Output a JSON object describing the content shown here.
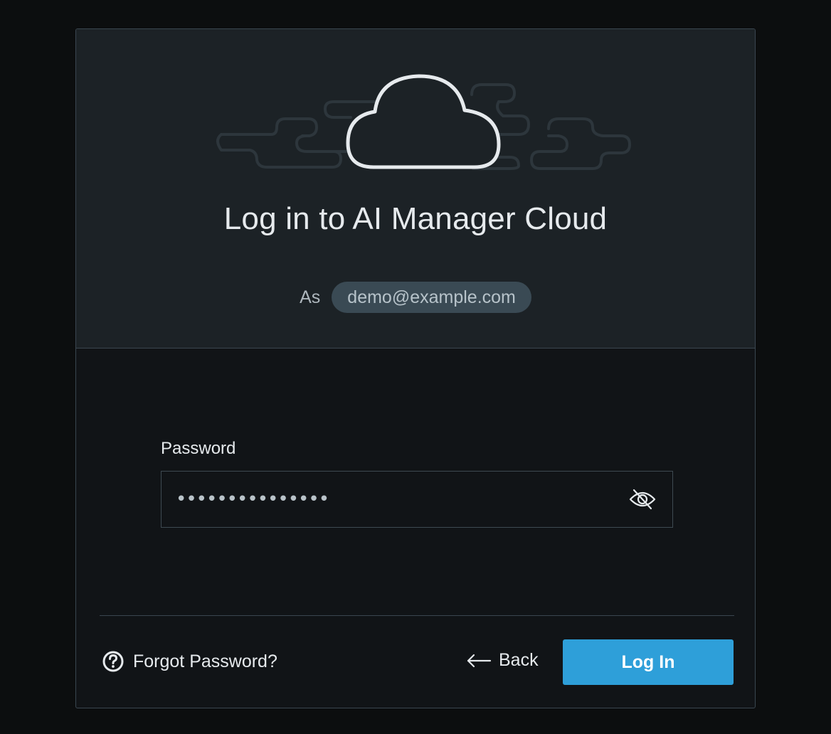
{
  "dialog": {
    "title": "Log in to AI Manager Cloud",
    "as_label": "As",
    "account_email": "demo@example.com"
  },
  "password": {
    "label": "Password",
    "masked_value": "•••••••••••••••",
    "visibility_icon": "eye-off-icon"
  },
  "footer": {
    "forgot_label": "Forgot Password?",
    "forgot_icon": "help-circle-icon",
    "back_label": "Back",
    "back_icon": "arrow-left-icon",
    "login_label": "Log In"
  },
  "colors": {
    "accent": "#2e9fd9",
    "header_bg": "#1c2226",
    "body_bg": "#111417",
    "chip_bg": "#3a4a54"
  }
}
